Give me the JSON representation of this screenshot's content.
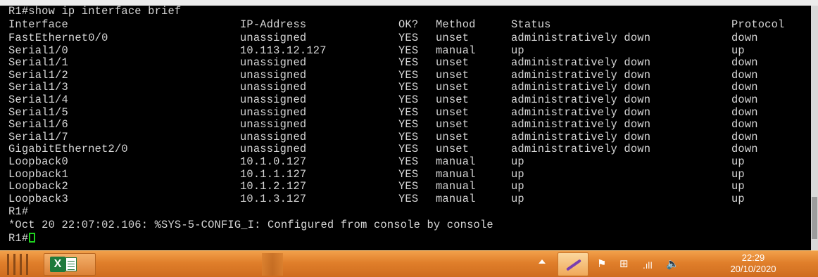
{
  "terminal": {
    "command_line": "R1#show ip interface brief",
    "headers": [
      "Interface",
      "IP-Address",
      "OK?",
      "Method",
      "Status",
      "Protocol"
    ],
    "rows": [
      [
        "FastEthernet0/0",
        "unassigned",
        "YES",
        "unset",
        "administratively down",
        "down"
      ],
      [
        "Serial1/0",
        "10.113.12.127",
        "YES",
        "manual",
        "up",
        "up"
      ],
      [
        "Serial1/1",
        "unassigned",
        "YES",
        "unset",
        "administratively down",
        "down"
      ],
      [
        "Serial1/2",
        "unassigned",
        "YES",
        "unset",
        "administratively down",
        "down"
      ],
      [
        "Serial1/3",
        "unassigned",
        "YES",
        "unset",
        "administratively down",
        "down"
      ],
      [
        "Serial1/4",
        "unassigned",
        "YES",
        "unset",
        "administratively down",
        "down"
      ],
      [
        "Serial1/5",
        "unassigned",
        "YES",
        "unset",
        "administratively down",
        "down"
      ],
      [
        "Serial1/6",
        "unassigned",
        "YES",
        "unset",
        "administratively down",
        "down"
      ],
      [
        "Serial1/7",
        "unassigned",
        "YES",
        "unset",
        "administratively down",
        "down"
      ],
      [
        "GigabitEthernet2/0",
        "unassigned",
        "YES",
        "unset",
        "administratively down",
        "down"
      ],
      [
        "Loopback0",
        "10.1.0.127",
        "YES",
        "manual",
        "up",
        "up"
      ],
      [
        "Loopback1",
        "10.1.1.127",
        "YES",
        "manual",
        "up",
        "up"
      ],
      [
        "Loopback2",
        "10.1.2.127",
        "YES",
        "manual",
        "up",
        "up"
      ],
      [
        "Loopback3",
        "10.1.3.127",
        "YES",
        "manual",
        "up",
        "up"
      ]
    ],
    "prompt_line": "R1#",
    "log_message": "*Oct 20 22:07:02.106: %SYS-5-CONFIG_I: Configured from console by console",
    "final_prompt": "R1#",
    "text_color": "#d6d6d6",
    "cursor_color": "#1fd21f",
    "background_color": "#000000"
  },
  "taskbar": {
    "pinned_app_icon": "excel-icon",
    "excel_icon_letter": "X",
    "tray_icons": [
      "show-hidden-icons-arrow",
      "pen-icon",
      "action-center-flag-icon",
      "network-icon",
      "signal-bars-icon",
      "speaker-icon"
    ],
    "clock_time": "22:29",
    "clock_date": "20/10/2020",
    "color": "#e07f2b"
  }
}
